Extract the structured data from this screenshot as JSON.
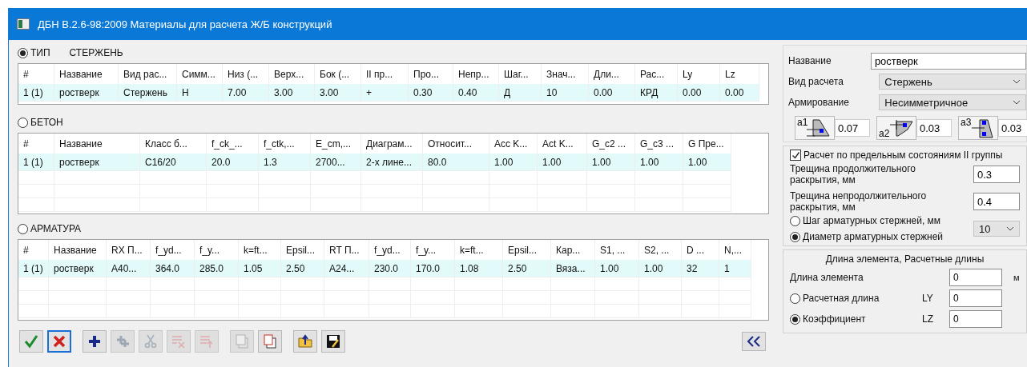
{
  "window": {
    "title": "ДБН В.2.6-98:2009  Материалы для расчета Ж/Б конструкций"
  },
  "sections": [
    {
      "label": "ТИП",
      "selected": true,
      "value": "СТЕРЖЕНЬ",
      "columns": [
        "#",
        "Название",
        "Вид рас...",
        "Симм...",
        "Низ (...",
        "Верх...",
        "Бок (...",
        "II пр...",
        "Про...",
        "Непр...",
        "Шаг...",
        "Знач...",
        "Дли...",
        "Рас...",
        "Ly",
        "Lz"
      ],
      "rows": [
        {
          "selected": true,
          "cells": [
            "1 (1)",
            "ростверк",
            "Стержень",
            "Н",
            "7.00",
            "3.00",
            "3.00",
            "+",
            "0.30",
            "0.40",
            "Д",
            "10",
            "0.00",
            "КРД",
            "0.00",
            "0.00"
          ]
        }
      ]
    },
    {
      "label": "БЕТОН",
      "selected": false,
      "columns": [
        "#",
        "Название",
        "Класс б...",
        "f_ck_...",
        "f_ctk,...",
        "E_cm,...",
        "Диаграм...",
        "Относит...",
        "Acc K...",
        "Act K...",
        "G_c2 ...",
        "G_c3 ...",
        "G Пре..."
      ],
      "rows": [
        {
          "selected": true,
          "cells": [
            "1 (1)",
            "ростверк",
            "C16/20",
            "20.0",
            "1.3",
            "2700...",
            "2-х лине...",
            "80.0",
            "1.00",
            "1.00",
            "1.00",
            "1.00",
            "1.00"
          ]
        }
      ]
    },
    {
      "label": "АРМАТУРА",
      "selected": false,
      "columns": [
        "#",
        "Название",
        "RX П...",
        "f_yd...",
        "f_y...",
        "k=ft...",
        "Epsil...",
        "RT П...",
        "f_yd...",
        "f_y...",
        "k=ft...",
        "Epsil...",
        "Кар...",
        "S1, ...",
        "S2, ...",
        "D ...",
        "N,..."
      ],
      "rows": [
        {
          "selected": true,
          "cells": [
            "1 (1)",
            "ростверк",
            "A40...",
            "364.0",
            "285.0",
            "1.05",
            "2.50",
            "A24...",
            "230.0",
            "170.0",
            "1.08",
            "2.50",
            "Вяза...",
            "1.00",
            "1.00",
            "32",
            "1"
          ]
        }
      ]
    }
  ],
  "toolbar_groups": [
    {
      "buttons": [
        {
          "kind": "ok",
          "disabled": false,
          "focused": false
        },
        {
          "kind": "cancel",
          "disabled": false,
          "focused": true
        }
      ]
    },
    {
      "buttons": [
        {
          "kind": "add",
          "disabled": false,
          "focused": false
        },
        {
          "kind": "add_many",
          "disabled": true,
          "focused": false
        },
        {
          "kind": "cut",
          "disabled": true,
          "focused": false
        },
        {
          "kind": "delete",
          "disabled": true,
          "focused": false
        },
        {
          "kind": "move",
          "disabled": true,
          "focused": false
        }
      ]
    },
    {
      "buttons": [
        {
          "kind": "copy",
          "disabled": true,
          "focused": false
        },
        {
          "kind": "paste",
          "disabled": false,
          "focused": false
        }
      ]
    },
    {
      "buttons": [
        {
          "kind": "open",
          "disabled": false,
          "focused": false
        },
        {
          "kind": "save",
          "disabled": false,
          "focused": false
        }
      ]
    }
  ],
  "properties": {
    "name": {
      "label": "Название",
      "value": "ростверк"
    },
    "calc_type": {
      "label": "Вид расчета",
      "value": "Стержень"
    },
    "reinforcement": {
      "label": "Армирование",
      "value": "Несимметричное"
    },
    "covers": [
      {
        "kind": "a1",
        "label": "a1",
        "value": "0.07"
      },
      {
        "kind": "a2",
        "label": "a2",
        "value": "0.03"
      },
      {
        "kind": "a3",
        "label": "a3",
        "value": "0.03"
      }
    ],
    "serviceability": {
      "label": "Расчет по предельным состояниям II группы",
      "checked": true,
      "fields": [
        {
          "label": "Трещина продолжительного раскрытия, мм",
          "value": "0.3"
        },
        {
          "label": "Трещина непродолжительного раскрытия, мм",
          "value": "0.4"
        }
      ],
      "options": [
        {
          "label": "Шаг арматурных стержней, мм",
          "selected": false
        },
        {
          "label": "Диаметр арматурных стержней",
          "selected": true
        }
      ],
      "bar_value": "10"
    },
    "lengths": {
      "title": "Длина элемента, Расчетные длины",
      "length_label": "Длина элемента",
      "length_value": "0",
      "unit": "м",
      "options": [
        {
          "label": "Расчетная длина",
          "selected": false,
          "axis": "LY",
          "value": "0"
        },
        {
          "label": "Коэффициент",
          "selected": true,
          "axis": "LZ",
          "value": "0"
        }
      ]
    }
  }
}
